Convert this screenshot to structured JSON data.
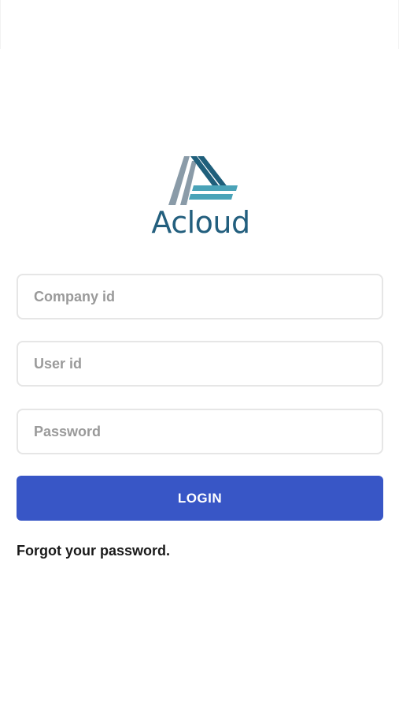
{
  "brand": {
    "name": "Acloud",
    "text_color": "#235f7e",
    "mark_colors": [
      "#8a9ba8",
      "#1f5f7b",
      "#4aa3b8"
    ]
  },
  "form": {
    "company_placeholder": "Company id",
    "user_placeholder": "User id",
    "password_placeholder": "Password",
    "login_label": "LOGIN",
    "login_color": "#3856c6",
    "forgot_label": "Forgot your password."
  }
}
